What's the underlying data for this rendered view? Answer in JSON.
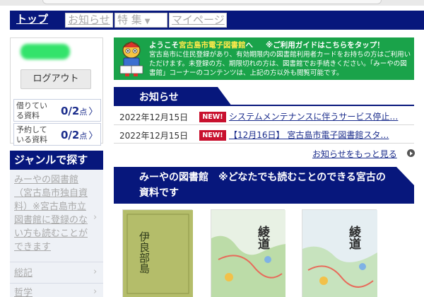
{
  "nav": {
    "top": "トップ",
    "news": "お知らせ",
    "feature": "特 集",
    "feature_arrow": "▼",
    "mypage": "マイページ"
  },
  "account": {
    "logout": "ログアウト",
    "borrowing_label": "借りている資料",
    "borrowing_value": "0/2",
    "borrowing_unit": "点",
    "reserved_label": "予約している資料",
    "reserved_value": "0/2",
    "reserved_unit": "点",
    "chevron": "〉"
  },
  "genre": {
    "heading": "ジャンルで探す",
    "items": [
      "みーやの図書館（宮古島市独自資料）※宮古島市立図書館に登録のない方も読むことができます",
      "総記",
      "哲学"
    ],
    "chevron": "›"
  },
  "banner": {
    "welcome_prefix": "ようこそ",
    "welcome_name": "宮古島市電子図書館",
    "welcome_suffix": "へ",
    "guide": "※ご利用ガイドはこちらをタップ！",
    "body": "宮古島市に住民登録があり、有効期限内の図書館利用者カードをお持ちの方はご利用いただけます。未登録の方、期限切れの方は、図書館でお手続きください。「みーやの図書館」コーナーのコンテンツは、上記の方以外も閲覧可能です。"
  },
  "news": {
    "heading": "お知らせ",
    "items": [
      {
        "date": "2022年12月15日",
        "badge": "NEW!",
        "title": "システムメンテナンスに伴うサービス停止…"
      },
      {
        "date": "2022年12月15日",
        "badge": "NEW!",
        "title": "【12月16日】 宮古島市電子図書館スタ…"
      }
    ],
    "more": "お知らせをもっと見る"
  },
  "miyako": {
    "heading": "みーやの図書館　※どなたでも読むことのできる宮古の資料です"
  },
  "books": [
    {
      "title": "伊良部島"
    },
    {
      "title": "綾道"
    },
    {
      "title": "綾道"
    }
  ],
  "colors": {
    "navy": "#07177c",
    "banner_green": "#1aa34a",
    "new_red": "#c8102e",
    "link_blue": "#1b2d8c"
  }
}
